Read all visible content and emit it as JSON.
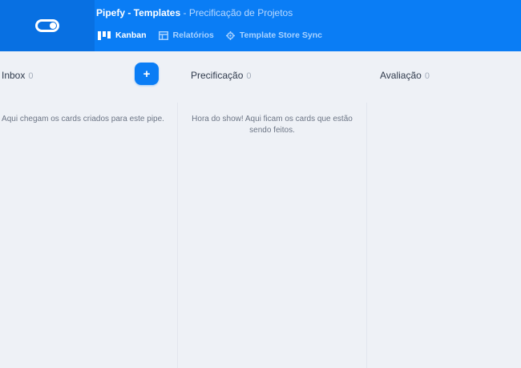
{
  "header": {
    "pipe_name": "Pipefy - Templates",
    "separator": " - ",
    "phase_name": "Precificação de Projetos"
  },
  "nav": {
    "items": [
      {
        "label": "Kanban",
        "icon": "kanban-icon",
        "active": true
      },
      {
        "label": "Relatórios",
        "icon": "table-icon",
        "active": false
      },
      {
        "label": "Template Store Sync",
        "icon": "sync-icon",
        "active": false
      }
    ]
  },
  "board": {
    "add_button_label": "+",
    "columns": [
      {
        "title": "Inbox",
        "count": "0",
        "empty_text": "Aqui chegam os cards criados para este pipe."
      },
      {
        "title": "Precificação",
        "count": "0",
        "empty_text": "Hora do show! Aqui ficam os cards que estão sendo feitos."
      },
      {
        "title": "Avaliação",
        "count": "0",
        "empty_text": ""
      }
    ]
  },
  "colors": {
    "brand_blue": "#0a7df5",
    "brand_blue_dark": "#0870e2",
    "background": "#eef1f6"
  }
}
